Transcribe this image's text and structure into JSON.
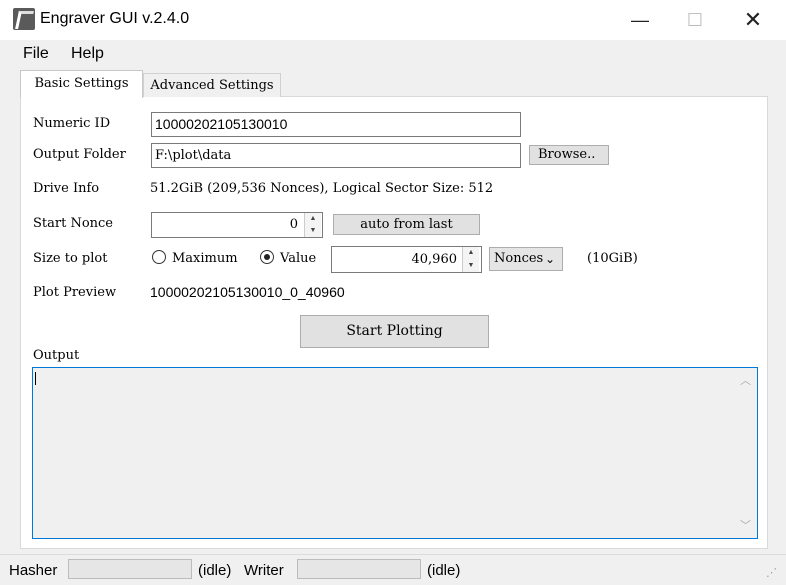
{
  "window": {
    "title": "Engraver GUI v.2.4.0",
    "minimize_glyph": "—",
    "maximize_glyph": "☐",
    "close_glyph": "✕"
  },
  "menu": {
    "file": "File",
    "help": "Help"
  },
  "tabs": {
    "basic": "Basic Settings",
    "advanced": "Advanced Settings"
  },
  "form": {
    "numeric_id": {
      "label": "Numeric ID",
      "value": "10000202105130010"
    },
    "output_folder": {
      "label": "Output Folder",
      "value": "F:\\plot\\data",
      "browse": "Browse.."
    },
    "drive_info": {
      "label": "Drive Info",
      "value": "51.2GiB (209,536 Nonces), Logical Sector Size: 512"
    },
    "start_nonce": {
      "label": "Start Nonce",
      "value": "0",
      "auto_button": "auto from last"
    },
    "size_to_plot": {
      "label": "Size to plot",
      "option_maximum": "Maximum",
      "option_value": "Value",
      "selected": "Value",
      "value": "40,960",
      "unit": "Nonces",
      "size_text": "(10GiB)"
    },
    "plot_preview": {
      "label": "Plot Preview",
      "value": "10000202105130010_0_40960"
    },
    "start_button": "Start Plotting",
    "output_label": "Output",
    "output_text": ""
  },
  "status": {
    "hasher_label": "Hasher",
    "hasher_progress": 0,
    "hasher_status": "(idle)",
    "writer_label": "Writer",
    "writer_progress": 0,
    "writer_status": "(idle)"
  },
  "icons": {
    "app": "engraver-app-icon",
    "spin_up": "▲",
    "spin_down": "▼",
    "dropdown": "⌄",
    "scroll_up": "︿",
    "scroll_down": "﹀",
    "grip": "⋰"
  },
  "colors": {
    "focus_border": "#0078d7",
    "window_bg": "#f0f0f0"
  }
}
